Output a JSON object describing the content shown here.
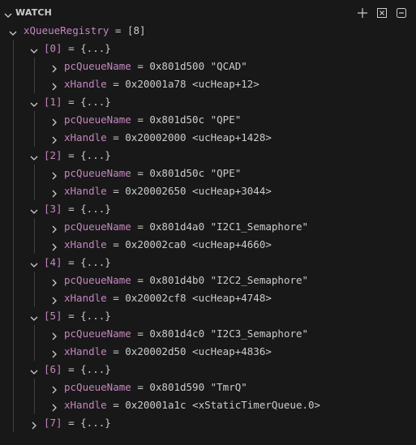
{
  "panel": {
    "title": "WATCH"
  },
  "toolbar": {
    "add_icon": "add-expression-icon",
    "collapse_icon": "collapse-all-icon",
    "remove_icon": "remove-all-expressions-icon"
  },
  "root": {
    "name": "xQueueRegistry",
    "eq": " = ",
    "value": "[8]"
  },
  "entries": [
    {
      "label": "[0]",
      "eq": " = ",
      "value": "{...}",
      "expanded": true,
      "children": [
        {
          "name": "pcQueueName",
          "eq": " = ",
          "value": "0x801d500 \"QCAD\""
        },
        {
          "name": "xHandle",
          "eq": " = ",
          "value": "0x20001a78 <ucHeap+12>"
        }
      ]
    },
    {
      "label": "[1]",
      "eq": " = ",
      "value": "{...}",
      "expanded": true,
      "children": [
        {
          "name": "pcQueueName",
          "eq": " = ",
          "value": "0x801d50c \"QPE\""
        },
        {
          "name": "xHandle",
          "eq": " = ",
          "value": "0x20002000 <ucHeap+1428>"
        }
      ]
    },
    {
      "label": "[2]",
      "eq": " = ",
      "value": "{...}",
      "expanded": true,
      "children": [
        {
          "name": "pcQueueName",
          "eq": " = ",
          "value": "0x801d50c \"QPE\""
        },
        {
          "name": "xHandle",
          "eq": " = ",
          "value": "0x20002650 <ucHeap+3044>"
        }
      ]
    },
    {
      "label": "[3]",
      "eq": " = ",
      "value": "{...}",
      "expanded": true,
      "children": [
        {
          "name": "pcQueueName",
          "eq": " = ",
          "value": "0x801d4a0 \"I2C1_Semaphore\""
        },
        {
          "name": "xHandle",
          "eq": " = ",
          "value": "0x20002ca0 <ucHeap+4660>"
        }
      ]
    },
    {
      "label": "[4]",
      "eq": " = ",
      "value": "{...}",
      "expanded": true,
      "children": [
        {
          "name": "pcQueueName",
          "eq": " = ",
          "value": "0x801d4b0 \"I2C2_Semaphore\""
        },
        {
          "name": "xHandle",
          "eq": " = ",
          "value": "0x20002cf8 <ucHeap+4748>"
        }
      ]
    },
    {
      "label": "[5]",
      "eq": " = ",
      "value": "{...}",
      "expanded": true,
      "children": [
        {
          "name": "pcQueueName",
          "eq": " = ",
          "value": "0x801d4c0 \"I2C3_Semaphore\""
        },
        {
          "name": "xHandle",
          "eq": " = ",
          "value": "0x20002d50 <ucHeap+4836>"
        }
      ]
    },
    {
      "label": "[6]",
      "eq": " = ",
      "value": "{...}",
      "expanded": true,
      "children": [
        {
          "name": "pcQueueName",
          "eq": " = ",
          "value": "0x801d590 \"TmrQ\""
        },
        {
          "name": "xHandle",
          "eq": " = ",
          "value": "0x20001a1c <xStaticTimerQueue.0>"
        }
      ]
    },
    {
      "label": "[7]",
      "eq": " = ",
      "value": "{...}",
      "expanded": false,
      "children": []
    }
  ]
}
